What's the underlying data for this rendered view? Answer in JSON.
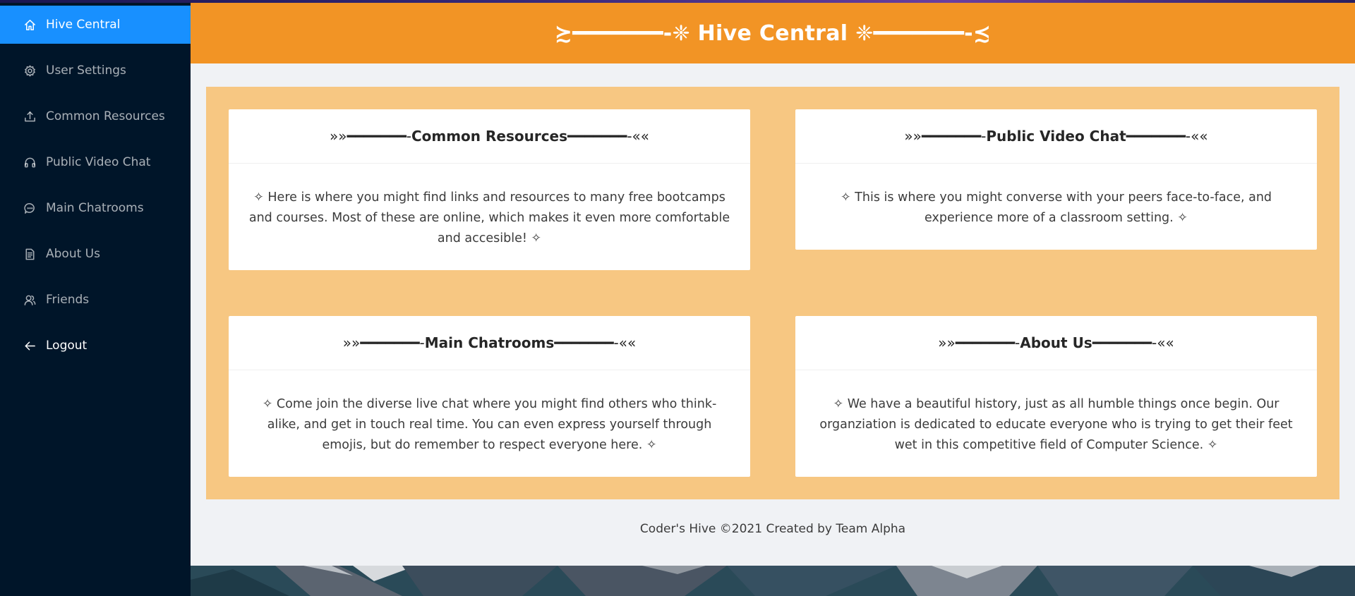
{
  "sidebar": {
    "items": [
      {
        "label": "Hive Central",
        "icon": "home-icon"
      },
      {
        "label": "User Settings",
        "icon": "gear-icon"
      },
      {
        "label": "Common Resources",
        "icon": "upload-icon"
      },
      {
        "label": "Public Video Chat",
        "icon": "headphones-icon"
      },
      {
        "label": "Main Chatrooms",
        "icon": "chat-icon"
      },
      {
        "label": "About Us",
        "icon": "document-icon"
      },
      {
        "label": "Friends",
        "icon": "users-icon"
      },
      {
        "label": "Logout",
        "icon": "arrow-left-icon"
      }
    ]
  },
  "header": {
    "title": "≿━━━━━━━-❈ Hive Central ❈━━━━━━━-≾"
  },
  "cards": [
    {
      "deco_left": "»»━━━━━━━- ",
      "title": "Common Resources",
      "deco_right": " ━━━━━━━-««",
      "body": "✧ Here is where you might find links and resources to many free bootcamps and courses. Most of these are online, which makes it even more comfortable and accesible! ✧"
    },
    {
      "deco_left": "»»━━━━━━━- ",
      "title": "Public Video Chat",
      "deco_right": " ━━━━━━━-««",
      "body": "✧ This is where you might converse with your peers face-to-face, and experience more of a classroom setting. ✧"
    },
    {
      "deco_left": "»»━━━━━━━- ",
      "title": "Main Chatrooms",
      "deco_right": " ━━━━━━━-««",
      "body": "✧ Come join the diverse live chat where you might find others who think-alike, and get in touch real time. You can even express yourself through emojis, but do remember to respect everyone here. ✧"
    },
    {
      "deco_left": "»»━━━━━━━- ",
      "title": "About Us",
      "deco_right": " ━━━━━━━-««",
      "body": "✧ We have a beautiful history, just as all humble things once begin. Our organziation is dedicated to educate everyone who is trying to get their feet wet in this competitive field of Computer Science. ✧"
    }
  ],
  "footer": {
    "text": "Coder's Hive ©2021 Created by Team Alpha"
  },
  "colors": {
    "sidebar": "#001529",
    "active": "#1890ff",
    "header": "#f29425",
    "panel": "#f7c782",
    "page": "#f0f2f5"
  }
}
